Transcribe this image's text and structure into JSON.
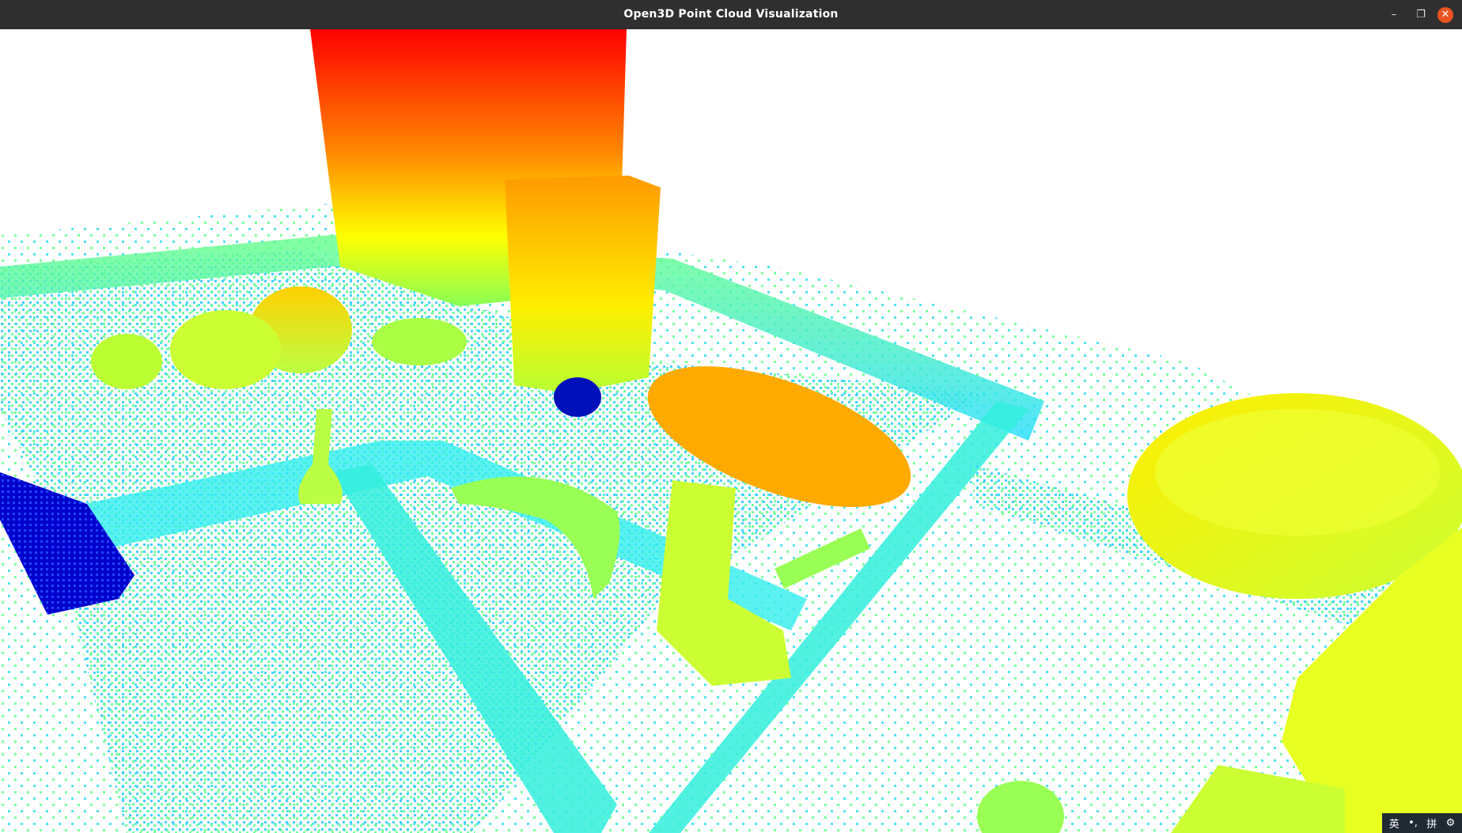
{
  "window": {
    "title": "Open3D Point Cloud Visualization",
    "controls": {
      "minimize": "–",
      "maximize": "❐",
      "close": "✕"
    }
  },
  "viewport": {
    "description_colors": {
      "high": "#ff0000",
      "mid": "#ffff00",
      "low": "#00ffff",
      "lowest": "#0000aa"
    }
  },
  "ime_bar": {
    "lang": "英",
    "punct": "•,",
    "mode": "拼",
    "settings_icon": "gear-icon"
  },
  "colors": {
    "titlebar": "#2f2f2f",
    "close": "#e95420",
    "ime_bg": "#1f2a33"
  }
}
